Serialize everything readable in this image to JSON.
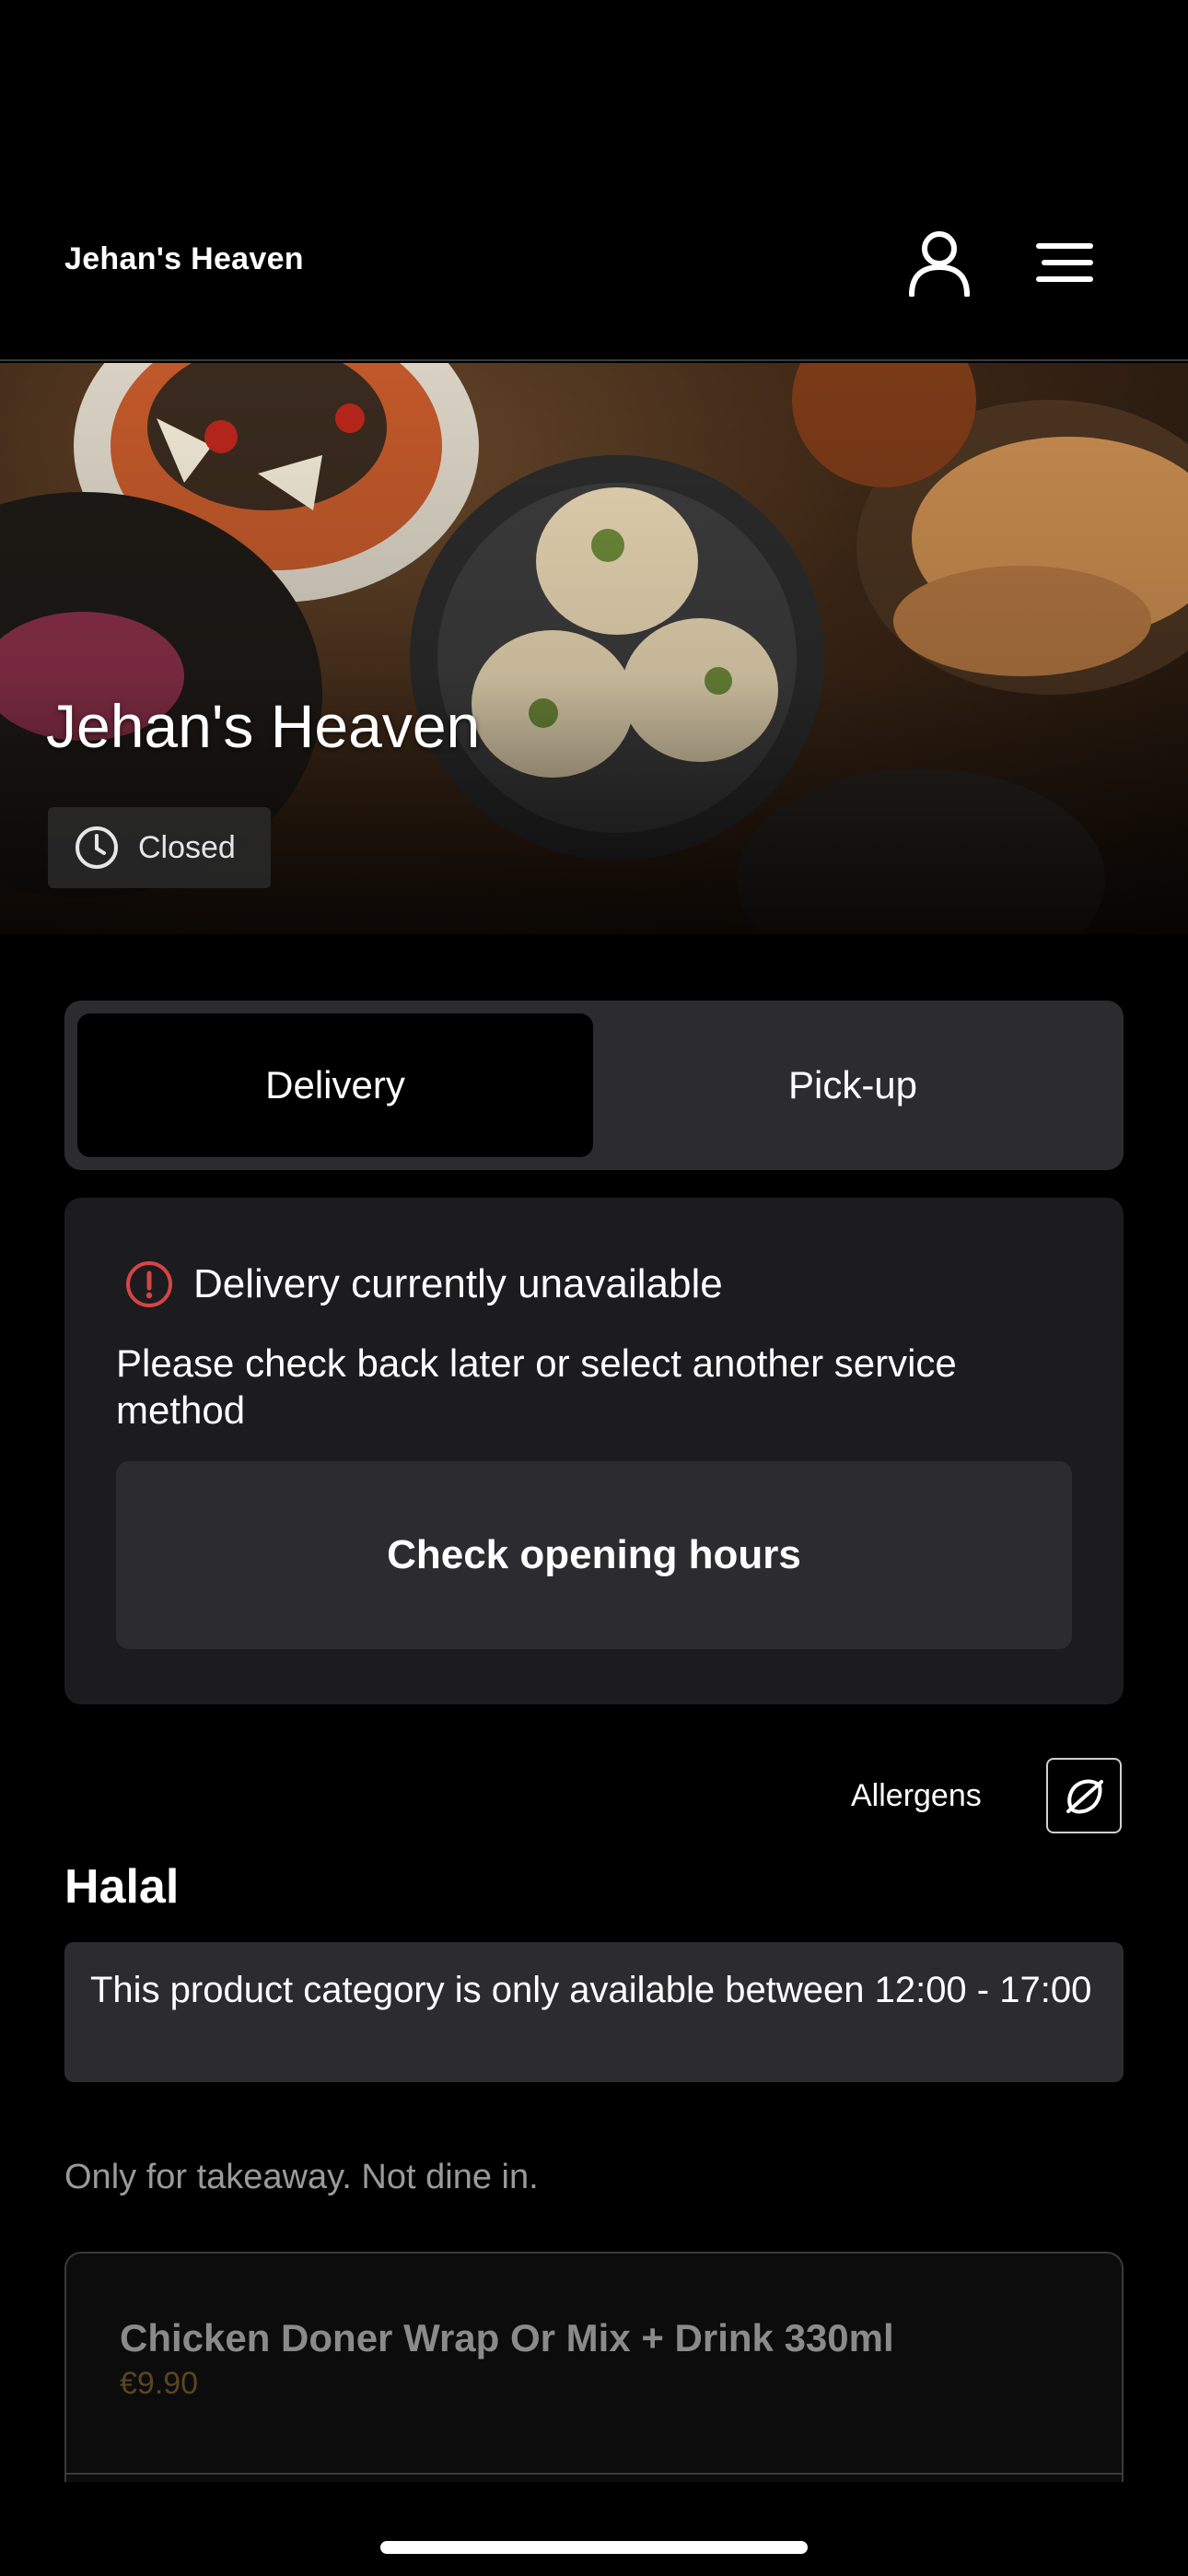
{
  "header": {
    "brand": "Jehan's Heaven",
    "icons": {
      "account": "user-icon",
      "menu": "hamburger-menu-icon"
    }
  },
  "hero": {
    "title": "Jehan's Heaven",
    "status": {
      "icon": "clock-icon",
      "label": "Closed"
    }
  },
  "service_toggle": {
    "options": [
      "Delivery",
      "Pick-up"
    ],
    "selected": "Delivery"
  },
  "notice": {
    "icon": "info-alert-icon",
    "title": "Delivery currently unavailable",
    "body": "Please check back later or select another service method",
    "button": "Check opening hours"
  },
  "allergens": {
    "label": "Allergens",
    "icon": "allergen-icon"
  },
  "category": {
    "title": "Halal",
    "availability": "This product category is only available  between 12:00 - 17:00",
    "description": "Only for takeaway. Not dine in."
  },
  "products": [
    {
      "name": "Chicken Doner Wrap Or Mix + Drink 330ml",
      "price": "€9.90"
    }
  ],
  "colors": {
    "background": "#000000",
    "card": "#1c1c1e",
    "surface": "#2c2c2e",
    "alert": "#d64545",
    "price_muted": "#5a4520"
  }
}
